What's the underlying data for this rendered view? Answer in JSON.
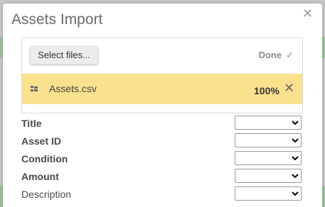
{
  "dialog": {
    "title": "Assets Import",
    "close_icon": "close-icon"
  },
  "upload": {
    "select_label": "Select files...",
    "status_label": "Done",
    "status_icon": "checkmark-icon",
    "files": [
      {
        "name": "Assets.csv",
        "progress": "100%",
        "progress_value": 1.0
      }
    ],
    "row_color": "#f9e18e"
  },
  "mapping": {
    "fields": [
      {
        "label": "Title",
        "required": true,
        "selected": ""
      },
      {
        "label": "Asset ID",
        "required": true,
        "selected": ""
      },
      {
        "label": "Condition",
        "required": true,
        "selected": ""
      },
      {
        "label": "Amount",
        "required": true,
        "selected": ""
      },
      {
        "label": "Description",
        "required": false,
        "selected": ""
      }
    ]
  }
}
